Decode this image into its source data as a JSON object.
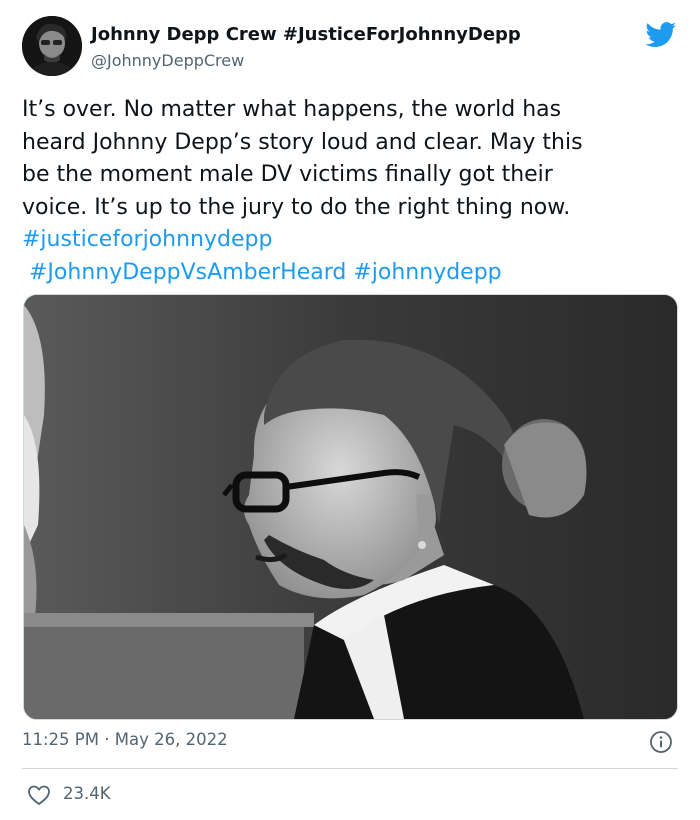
{
  "tweet": {
    "display_name": "Johnny Depp Crew #JusticeForJohnnyDepp",
    "handle": "@JohnnyDeppCrew",
    "text_lines": [
      "It’s over. No matter what happens, the world has",
      "heard Johnny Depp’s story loud and clear. May this",
      "be the moment male DV victims finally got their",
      "voice. It’s up to the jury to do the right thing now."
    ],
    "hashtags": [
      "#justiceforjohnnydepp",
      "#JohnnyDeppVsAmberHeard",
      "#johnnydepp"
    ],
    "time": "11:25 PM",
    "separator": "·",
    "date": "May 26, 2022",
    "likes": "23.4K"
  },
  "colors": {
    "brand_blue": "#1d9bf0",
    "text": "#0f1419",
    "muted": "#536471",
    "border": "#cfd9de"
  },
  "icons": {
    "logo": "twitter-bird-icon",
    "info": "info-icon",
    "like": "heart-icon"
  }
}
